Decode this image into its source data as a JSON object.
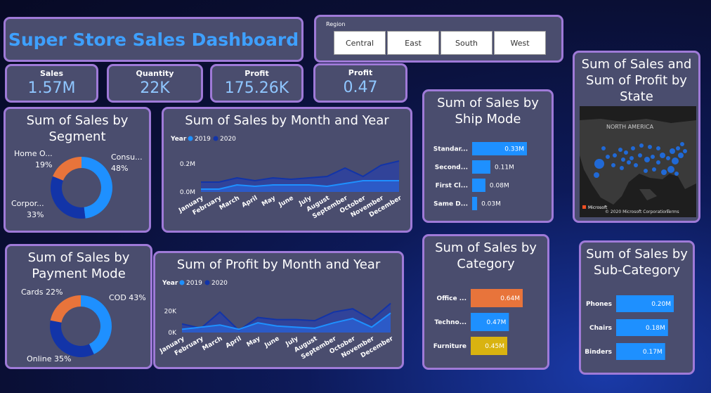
{
  "header": {
    "title": "Super Store Sales Dashboard"
  },
  "slicer": {
    "label": "Region",
    "options": [
      "Central",
      "East",
      "South",
      "West"
    ]
  },
  "kpis": {
    "sales": {
      "label": "Sales",
      "value": "1.57M"
    },
    "quantity": {
      "label": "Quantity",
      "value": "22K"
    },
    "profit": {
      "label": "Profit",
      "value": "175.26K"
    },
    "profit_ratio": {
      "label": "Profit",
      "value": "0.47"
    }
  },
  "colors": {
    "accent": "#3ea0ff",
    "orange": "#e8743b",
    "navy": "#1234a8",
    "gold": "#d9b310",
    "border": "#9f7ad8"
  },
  "chart_data": [
    {
      "id": "segment",
      "type": "pie",
      "title": "Sum of Sales by Segment",
      "labels": [
        "Consu...",
        "Corpor...",
        "Home O..."
      ],
      "percent_labels": [
        "48%",
        "33%",
        "19%"
      ],
      "values": [
        48,
        33,
        19
      ]
    },
    {
      "id": "payment",
      "type": "pie",
      "title": "Sum of Sales by Payment Mode",
      "labels": [
        "COD 43%",
        "Online 35%",
        "Cards 22%"
      ],
      "values": [
        43,
        35,
        22
      ]
    },
    {
      "id": "sales_month",
      "type": "area",
      "title": "Sum of Sales by Month and Year",
      "legend_title": "Year",
      "categories": [
        "January",
        "February",
        "March",
        "April",
        "May",
        "June",
        "July",
        "August",
        "September",
        "October",
        "November",
        "December"
      ],
      "series": [
        {
          "name": "2019",
          "values": [
            0.02,
            0.02,
            0.05,
            0.04,
            0.05,
            0.05,
            0.05,
            0.04,
            0.06,
            0.08,
            0.08,
            0.08
          ]
        },
        {
          "name": "2020",
          "values": [
            0.07,
            0.07,
            0.1,
            0.08,
            0.1,
            0.09,
            0.1,
            0.11,
            0.17,
            0.11,
            0.19,
            0.22
          ]
        }
      ],
      "y_ticks": [
        "0.0M",
        "0.2M"
      ],
      "ylim": [
        0,
        0.25
      ]
    },
    {
      "id": "profit_month",
      "type": "area",
      "title": "Sum of Profit by Month and Year",
      "legend_title": "Year",
      "categories": [
        "January",
        "February",
        "March",
        "April",
        "May",
        "June",
        "July",
        "August",
        "September",
        "October",
        "November",
        "December"
      ],
      "series": [
        {
          "name": "2019",
          "values": [
            3000,
            5000,
            7000,
            3000,
            9000,
            6000,
            5000,
            4000,
            9000,
            13000,
            5000,
            18000
          ]
        },
        {
          "name": "2020",
          "values": [
            8000,
            4000,
            19000,
            2000,
            14000,
            12000,
            12000,
            11000,
            19000,
            22000,
            12000,
            27000
          ]
        }
      ],
      "y_ticks": [
        "0K",
        "20K"
      ],
      "ylim": [
        0,
        28000
      ]
    },
    {
      "id": "ship_mode",
      "type": "bar",
      "title": "Sum of Sales by Ship Mode",
      "categories": [
        "Standar...",
        "Second...",
        "First Cl...",
        "Same D..."
      ],
      "values": [
        0.33,
        0.11,
        0.08,
        0.03
      ],
      "value_labels": [
        "0.33M",
        "0.11M",
        "0.08M",
        "0.03M"
      ]
    },
    {
      "id": "category",
      "type": "bar",
      "title": "Sum of Sales by Category",
      "categories": [
        "Office ...",
        "Techno...",
        "Furniture"
      ],
      "values": [
        0.64,
        0.47,
        0.45
      ],
      "value_labels": [
        "0.64M",
        "0.47M",
        "0.45M"
      ],
      "colors": [
        "#e8743b",
        "#1e90ff",
        "#d9b310"
      ]
    },
    {
      "id": "sub_category",
      "type": "bar",
      "title": "Sum of Sales by Sub-Category",
      "categories": [
        "Phones",
        "Chairs",
        "Binders"
      ],
      "values": [
        0.2,
        0.18,
        0.17
      ],
      "value_labels": [
        "0.20M",
        "0.18M",
        "0.17M"
      ]
    }
  ],
  "map": {
    "title": "Sum of Sales and Sum of Profit by State",
    "region_label": "NORTH AMERICA",
    "attribution": "© 2020 Microsoft Corporation",
    "terms": "Terms",
    "brand": "Microsoft"
  }
}
